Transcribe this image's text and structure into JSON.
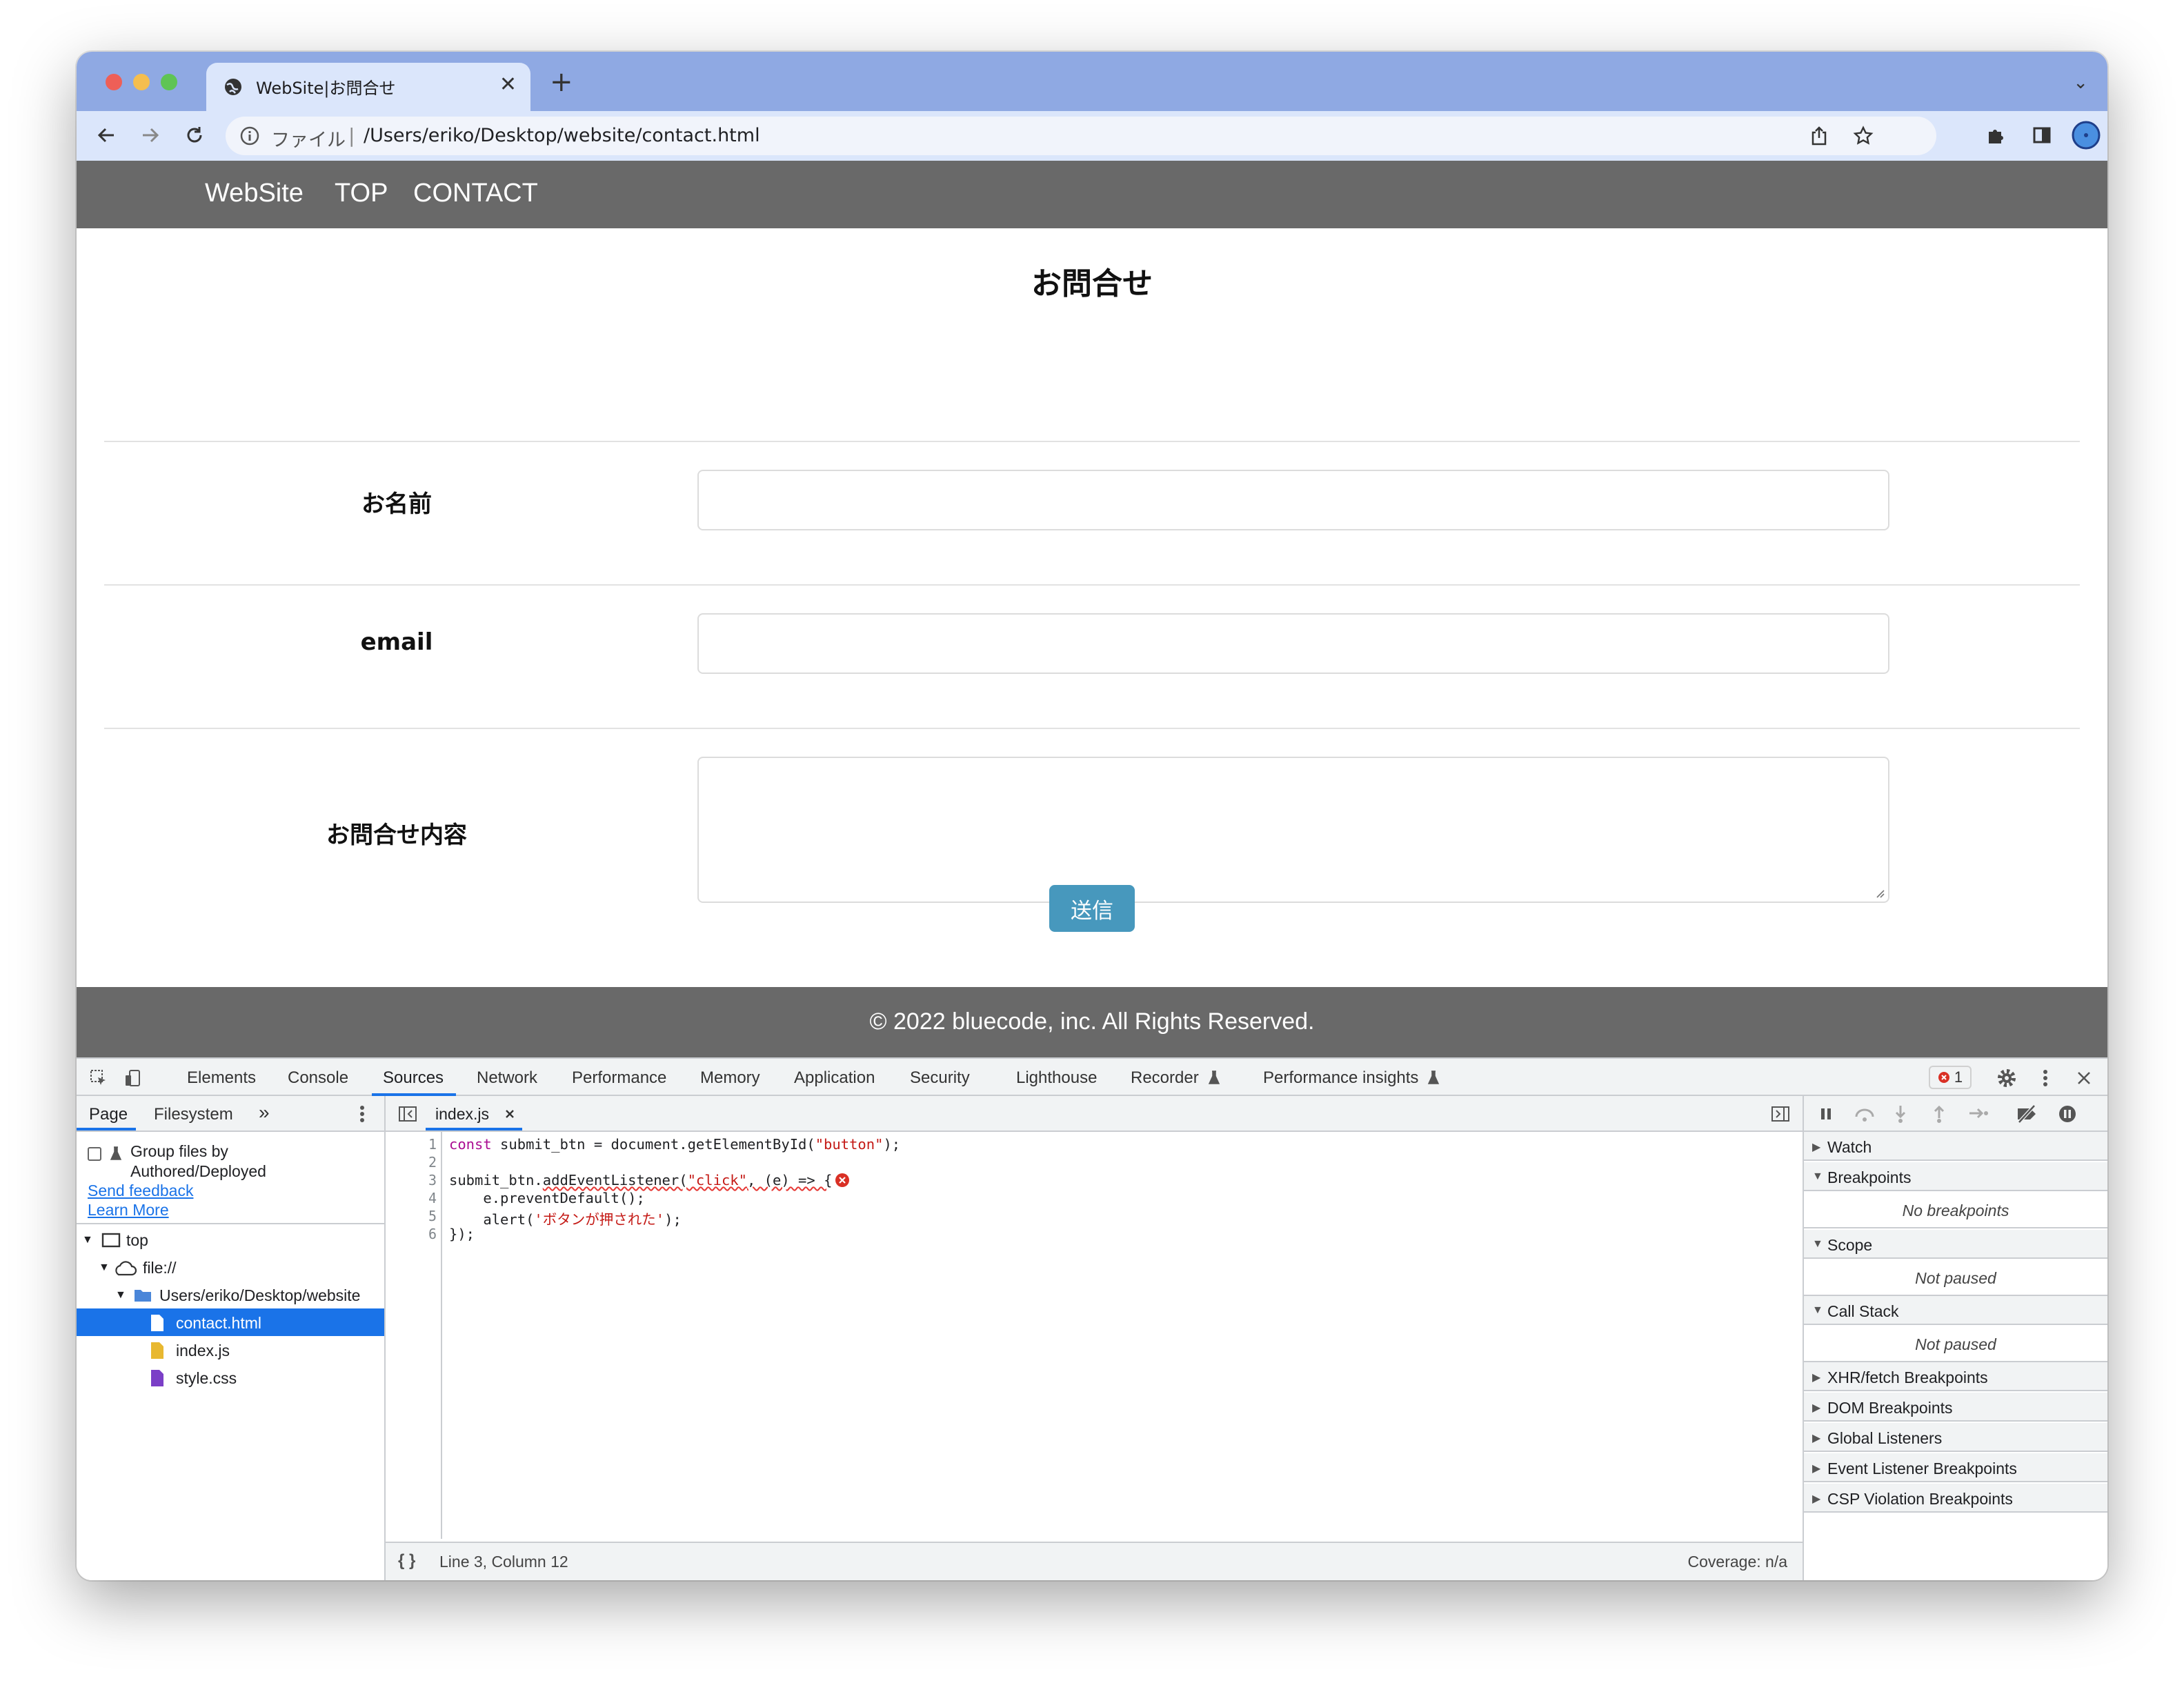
{
  "browser": {
    "tab_title": "WebSite|お問合せ",
    "tab_close": "✕",
    "new_tab": "+",
    "tab_menu": "⌄",
    "url_scheme": "ファイル",
    "url_separator": "|",
    "url": "/Users/eriko/Desktop/website/contact.html"
  },
  "site": {
    "nav": {
      "brand": "WebSite",
      "top": "TOP",
      "contact": "CONTACT"
    },
    "title": "お問合せ",
    "fields": [
      {
        "label": "お名前"
      },
      {
        "label": "email"
      },
      {
        "label": "お問合せ内容"
      }
    ],
    "submit_label": "送信",
    "footer": "© 2022 bluecode, inc. All Rights Reserved."
  },
  "devtools": {
    "tabs": [
      "Elements",
      "Console",
      "Sources",
      "Network",
      "Performance",
      "Memory",
      "Application",
      "Security",
      "Lighthouse",
      "Recorder",
      "Performance insights"
    ],
    "active_tab": "Sources",
    "error_count": "1",
    "navigator": {
      "tabs": [
        "Page",
        "Filesystem",
        "»"
      ],
      "group_label_1": "Group files by",
      "group_label_2": "Authored/Deployed",
      "send_feedback": "Send feedback",
      "learn_more": "Learn More",
      "tree": [
        "top",
        "file://",
        "Users/eriko/Desktop/website",
        "contact.html",
        "index.js",
        "style.css"
      ]
    },
    "editor": {
      "file_tab": "index.js",
      "line_numbers": [
        "1",
        "2",
        "3",
        "4",
        "5",
        "6"
      ],
      "lines": [
        "const submit_btn = document.getElementById(\"button\");",
        "",
        "submit_btn.addEventListener(\"click\", (e) => {",
        "    e.preventDefault();",
        "    alert('ボタンが押された');",
        "});"
      ],
      "status_position": "Line 3, Column 12",
      "status_coverage": "Coverage: n/a",
      "format_icon": "{ }"
    },
    "debugger": {
      "sections": [
        "Watch",
        "Breakpoints",
        "Scope",
        "Call Stack",
        "XHR/fetch Breakpoints",
        "DOM Breakpoints",
        "Global Listeners",
        "Event Listener Breakpoints",
        "CSP Violation Breakpoints"
      ],
      "no_breakpoints": "No breakpoints",
      "not_paused": "Not paused"
    }
  },
  "colors": {
    "header_bg": "#696969",
    "submit_bg": "#4798bd",
    "titlebar": "#8fa9e3",
    "toolbar": "#dbe6fb",
    "accent": "#1a73e8"
  }
}
